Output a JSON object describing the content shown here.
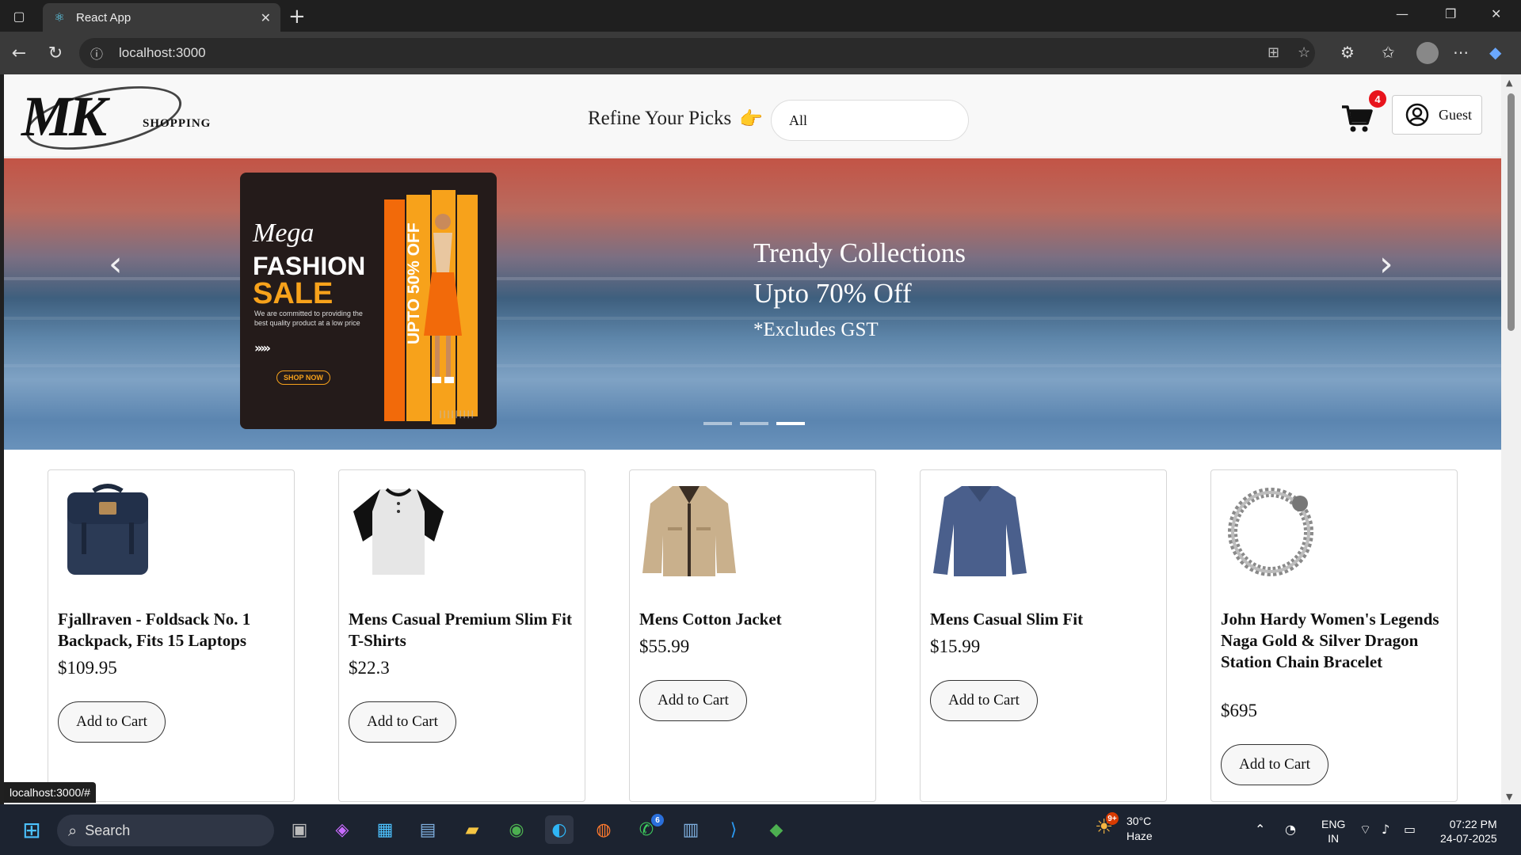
{
  "browser": {
    "tab_title": "React App",
    "url": "localhost:3000",
    "status_url": "localhost:3000/#"
  },
  "header": {
    "logo_text": "MK",
    "logo_subtext": "SHOPPING",
    "refine_label": "Refine Your Picks",
    "refine_emoji": "👉",
    "filter_value": "All",
    "cart_count": "4",
    "user_label": "Guest"
  },
  "carousel": {
    "line1": "Trendy Collections",
    "line2": "Upto 70% Off",
    "line3": "*Excludes GST",
    "promo": {
      "mega": "Mega",
      "fashion": "FASHION",
      "sale": "SALE",
      "desc": "We are committed to providing the best quality product at a low price",
      "shop_now": "SHOP NOW",
      "upto": "UPTO 50% OFF"
    },
    "active_slide": 3,
    "slide_count": 3
  },
  "products": [
    {
      "name": "Fjallraven - Foldsack No. 1 Backpack, Fits 15 Laptops",
      "price": "$109.95",
      "button": "Add to Cart",
      "icon": "backpack-icon"
    },
    {
      "name": "Mens Casual Premium Slim Fit T-Shirts",
      "price": "$22.3",
      "button": "Add to Cart",
      "icon": "tshirt-icon"
    },
    {
      "name": "Mens Cotton Jacket",
      "price": "$55.99",
      "button": "Add to Cart",
      "icon": "jacket-icon"
    },
    {
      "name": "Mens Casual Slim Fit",
      "price": "$15.99",
      "button": "Add to Cart",
      "icon": "longsleeve-icon"
    },
    {
      "name": "John Hardy Women's Legends Naga Gold & Silver Dragon Station Chain Bracelet",
      "price": "$695",
      "button": "Add to Cart",
      "icon": "bracelet-icon"
    }
  ],
  "taskbar": {
    "search_label": "Search",
    "weather_temp": "30°C",
    "weather_desc": "Haze",
    "weather_badge": "9+",
    "whatsapp_badge": "6",
    "lang_line1": "ENG",
    "lang_line2": "IN",
    "time": "07:22 PM",
    "date": "24-07-2025"
  },
  "colors": {
    "accent_badge": "#e8141c",
    "promo_orange": "#f7a21b",
    "taskbar_bg": "#1c2330"
  }
}
